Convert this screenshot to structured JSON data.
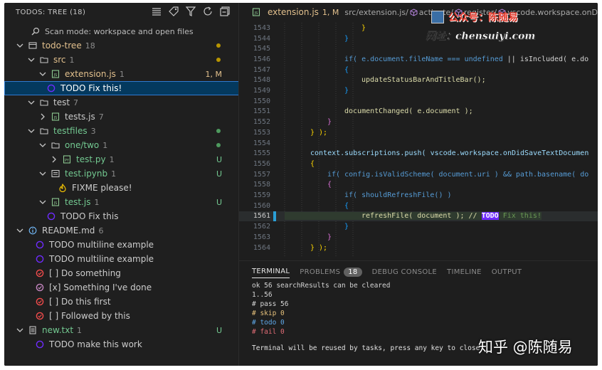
{
  "sidebar": {
    "title": "TODOS: TREE (18)",
    "tools": [
      "list-flat-icon",
      "tag-icon",
      "filter-icon",
      "refresh-icon",
      "collapse-all-icon"
    ],
    "rows": [
      {
        "label": "Scan mode: workspace and open files",
        "icon": "search-icon"
      },
      {
        "label": "todo-tree",
        "count": "18",
        "icon": "folder-root-icon"
      },
      {
        "label": "src",
        "count": "1",
        "icon": "folder-icon"
      },
      {
        "label": "extension.js",
        "count": "1",
        "status": "1, M",
        "icon": "js-file-icon"
      },
      {
        "label": "TODO Fix this!",
        "icon": "todo-circle-icon"
      },
      {
        "label": "test",
        "count": "7",
        "icon": "folder-icon"
      },
      {
        "label": "tests.js",
        "count": "7",
        "icon": "js-file-icon"
      },
      {
        "label": "testfiles",
        "count": "3",
        "icon": "folder-icon"
      },
      {
        "label": "one/two",
        "count": "1",
        "icon": "folder-icon"
      },
      {
        "label": "test.py",
        "count": "1",
        "status": "U",
        "icon": "py-file-icon"
      },
      {
        "label": "test.ipynb",
        "count": "1",
        "status": "U",
        "icon": "notebook-file-icon"
      },
      {
        "label": "FIXME please!",
        "icon": "flame-icon"
      },
      {
        "label": "test.js",
        "count": "1",
        "status": "U",
        "icon": "js-file-icon"
      },
      {
        "label": "TODO Fix this",
        "icon": "todo-circle-icon"
      },
      {
        "label": "README.md",
        "count": "6",
        "icon": "info-icon"
      },
      {
        "label": "TODO multiline example",
        "icon": "todo-circle-icon"
      },
      {
        "label": "TODO multiline example",
        "icon": "todo-circle-icon"
      },
      {
        "label": "[ ] Do something",
        "icon": "unchecked-circle-icon"
      },
      {
        "label": "[x] Something I've done",
        "icon": "checked-circle-icon"
      },
      {
        "label": "[ ] Do this first",
        "icon": "unchecked-circle-icon"
      },
      {
        "label": "[ ] Followed by this",
        "icon": "unchecked-circle-icon"
      },
      {
        "label": "new.txt",
        "count": "1",
        "status": "U",
        "icon": "text-file-icon"
      },
      {
        "label": "TODO make this work",
        "icon": "todo-circle-icon"
      }
    ]
  },
  "editor": {
    "breadcrumb": {
      "file": "extension.js",
      "status": "1, M",
      "path": "src/extension.js/",
      "s1": "activate/",
      "s2": "register/",
      "s3": "vscode.workspace.onDidSave"
    },
    "line_numbers": [
      "1543",
      "1544",
      "1545",
      "1546",
      "1547",
      "1548",
      "1549",
      "1550",
      "1551",
      "1552",
      "1553",
      "1554",
      "1555",
      "1556",
      "1557",
      "1558",
      "1559",
      "1560",
      "1561",
      "1562",
      "1563",
      "1564"
    ],
    "current_line": "1561",
    "code": {
      "l1543": "}",
      "l1544": "}",
      "l1546a": "if( e.document.fileName === ",
      "l1546b": "undefined",
      "l1546c": " || isIncluded( e.do",
      "l1547": "{",
      "l1548": "updateStatusBarAndTitleBar();",
      "l1549": "}",
      "l1551": "documentChanged( e.document );",
      "l1552": "}",
      "l1553": "} );",
      "l1555": "context.subscriptions.push( vscode.workspace.onDidSaveTextDocumen",
      "l1556": "{",
      "l1557a": "if( config.isValidScheme( document.uri ) && path.basename( do",
      "l1558": "{",
      "l1559": "if( shouldRefreshFile() )",
      "l1560": "{",
      "l1561a": "refreshFile( document ); // ",
      "l1561b": "TODO",
      "l1561c": " Fix this!",
      "l1562": "}",
      "l1563": "}",
      "l1564": "} );"
    }
  },
  "watermark": {
    "line1": "公众号：陈随易",
    "line2": "网址：chensuiyi.com"
  },
  "terminal": {
    "tabs": [
      {
        "label": "TERMINAL"
      },
      {
        "label": "PROBLEMS",
        "badge": "18"
      },
      {
        "label": "DEBUG CONSOLE"
      },
      {
        "label": "TIMELINE"
      },
      {
        "label": "OUTPUT"
      }
    ],
    "lines": [
      "ok 56 searchResults can be cleared",
      "1..56",
      "# pass 56",
      "# skip 0",
      "# todo 0",
      "# fail 0",
      "Terminal will be reused by tasks, press any key to close"
    ]
  },
  "zhihu_watermark": "知乎 @陈随易",
  "colors": {
    "accent": "#2f7ad0",
    "todo_purple": "#6f2bff",
    "added": "#73c991",
    "modified": "#e2c08d",
    "error_red": "#f14c4c"
  }
}
